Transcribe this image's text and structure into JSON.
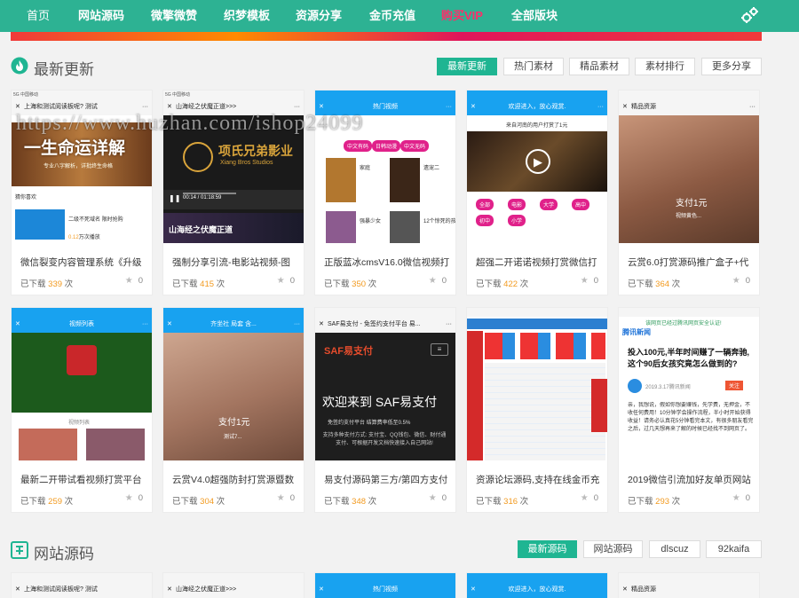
{
  "nav": {
    "items": [
      "首页",
      "网站源码",
      "微擎微赞",
      "织梦模板",
      "资源分享",
      "金币充值",
      "购买VIP",
      "全部版块"
    ]
  },
  "colors": {
    "nav_bg": "#2db293",
    "accent": "#1fb592",
    "count": "#f29a1f",
    "vip": "#ff2d6a"
  },
  "watermark": "https://www.huzhan.com/ishop24099",
  "latest": {
    "title": "最新更新",
    "icon": "flame-icon",
    "tabs": [
      "最新更新",
      "热门素材",
      "精品素材",
      "素材排行",
      "更多分享"
    ],
    "cards": [
      {
        "title": "微信裂变内容管理系统《升级",
        "dl_label": "已下载",
        "count": "339",
        "unit": "次",
        "likes": "0",
        "thumb": {
          "status": "5G 中国移动",
          "bar": "上海和测试阅读板呢? 测试",
          "headline": "一生命运详解",
          "sub": "专业八字解析，详批终生命格",
          "label": "猜你喜欢",
          "promo": "二级不死域名 限时抢购",
          "plays": "0.12",
          "plays_unit": "万次播放"
        }
      },
      {
        "title": "强制分享引流-电影站视频-图",
        "dl_label": "已下载",
        "count": "415",
        "unit": "次",
        "likes": "0",
        "thumb": {
          "status": "5G 中国移动",
          "bar": "山海经之伏魔正道>>>",
          "brand": "项氏兄弟影业",
          "brand_en": "Xiang Bros Studios",
          "time": "00:14 / 01:18:59",
          "caption": "山海经之伏魔正道"
        }
      },
      {
        "title": "正版蓝冰cmsV16.0微信视频打",
        "dl_label": "已下载",
        "count": "350",
        "unit": "次",
        "likes": "0",
        "thumb": {
          "bar": "热门视频",
          "chips": [
            "中文有码",
            "日韩动漫",
            "中文无码"
          ],
          "t1": "家庭",
          "t2": "遗宠二",
          "t3": "强暴少女",
          "t4": "12个惊死的孩子"
        }
      },
      {
        "title": "超强二开诺诺视频打赏微信打",
        "dl_label": "已下载",
        "count": "422",
        "unit": "次",
        "likes": "0",
        "thumb": {
          "bar": "欢迎进入，放心观赏.",
          "notice": "来自河南的用户打赏了1元",
          "chips": [
            "全部",
            "电影",
            "大学",
            "高中",
            "初中",
            "小学"
          ]
        }
      },
      {
        "title": "云赏6.0打赏源码推广盒子+代",
        "dl_label": "已下载",
        "count": "364",
        "unit": "次",
        "likes": "0",
        "thumb": {
          "bar": "精品资源",
          "pay": "支付1元",
          "sub": "视频黄色..."
        }
      },
      {
        "title": "最新二开带试看视频打赏平台",
        "dl_label": "已下载",
        "count": "259",
        "unit": "次",
        "likes": "0",
        "thumb": {
          "bar": "视频列表",
          "label": "视频列表"
        }
      },
      {
        "title": "云赏V4.0超强防封打赏源暨数",
        "dl_label": "已下载",
        "count": "304",
        "unit": "次",
        "likes": "0",
        "thumb": {
          "bar": "齐坐社 局套 含...",
          "pay": "支付1元",
          "sub": "测试7..."
        }
      },
      {
        "title": "易支付源码第三方/第四方支付",
        "dl_label": "已下载",
        "count": "348",
        "unit": "次",
        "likes": "0",
        "thumb": {
          "bar": "SAF易支付 - 免签约支付平台 易...",
          "logo": "SAF易支付",
          "headline": "欢迎来到 SAF易支付",
          "sub1": "免签约支付平台 结算费率低至0.5%",
          "sub2": "支持多种支付方式: 支付宝、QQ钱包、微信、财付通支付、可根据开发文档快速接入自己网站!"
        }
      },
      {
        "title": "资源论坛源码,支持在线金币充",
        "dl_label": "已下载",
        "count": "316",
        "unit": "次",
        "likes": "0",
        "thumb": {}
      },
      {
        "title": "2019微信引流加好友单页网站",
        "dl_label": "已下载",
        "count": "293",
        "unit": "次",
        "likes": "0",
        "thumb": {
          "notice": "该网页已经过腾讯网页安全认证!",
          "source": "腾讯新闻",
          "headline": "投入100元,半年时间赚了一辆奔驰,这个90后女孩究竟怎么做到的?",
          "date": "2019.3.17腾讯新闻",
          "tag": "关注",
          "body": "亲，我想说，假如你想要赚钱，先学费，无押金，不收任何费用！10分钟学会操作流程，半小时开始获得收益！请务必认真花5分钟看完本文，有很多朋友看完之后，过几天想再来了解的时候已经找不到网页了。"
        }
      }
    ]
  },
  "source": {
    "title": "网站源码",
    "icon": "source-icon",
    "tabs": [
      "最新源码",
      "网站源码",
      "dlscuz",
      "92kaifa"
    ],
    "preview_bars": [
      "上海和测试阅读板呢? 测试",
      "山海经之伏魔正道>>>",
      "热门视频",
      "欢迎进入，放心观赏.",
      "精品资源"
    ]
  }
}
